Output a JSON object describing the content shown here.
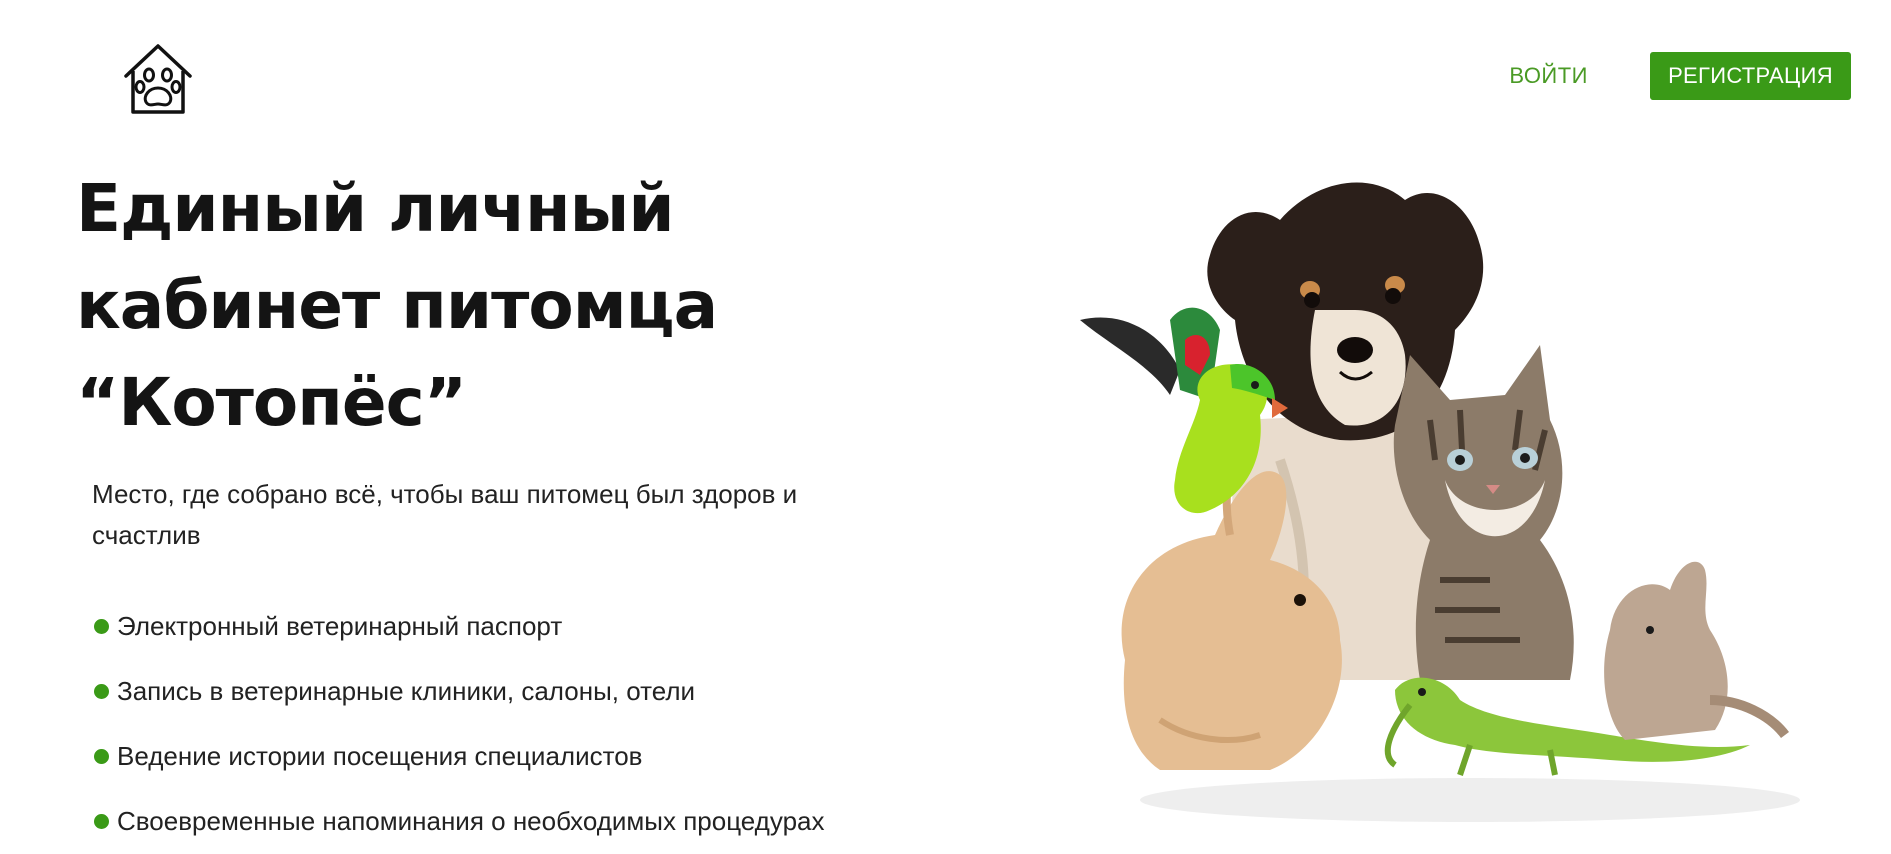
{
  "header": {
    "logo_icon": "pet-house-paw-icon",
    "login_label": "ВОЙТИ",
    "register_label": "РЕГИСТРАЦИЯ"
  },
  "hero": {
    "title_lines": [
      "Единый личный",
      "кабинет питомца",
      "“Котопёс”"
    ],
    "subtitle": "Место, где собрано всё, чтобы ваш питомец был здоров и счастлив",
    "features": [
      "Электронный ветеринарный паспорт",
      "Запись в ветеринарные клиники, салоны, отели",
      "Ведение истории посещения специалистов",
      "Своевременные напоминания о необходимых процедурах"
    ]
  },
  "colors": {
    "accent": "#3a9a17",
    "link": "#4a9a25",
    "text": "#141414"
  }
}
